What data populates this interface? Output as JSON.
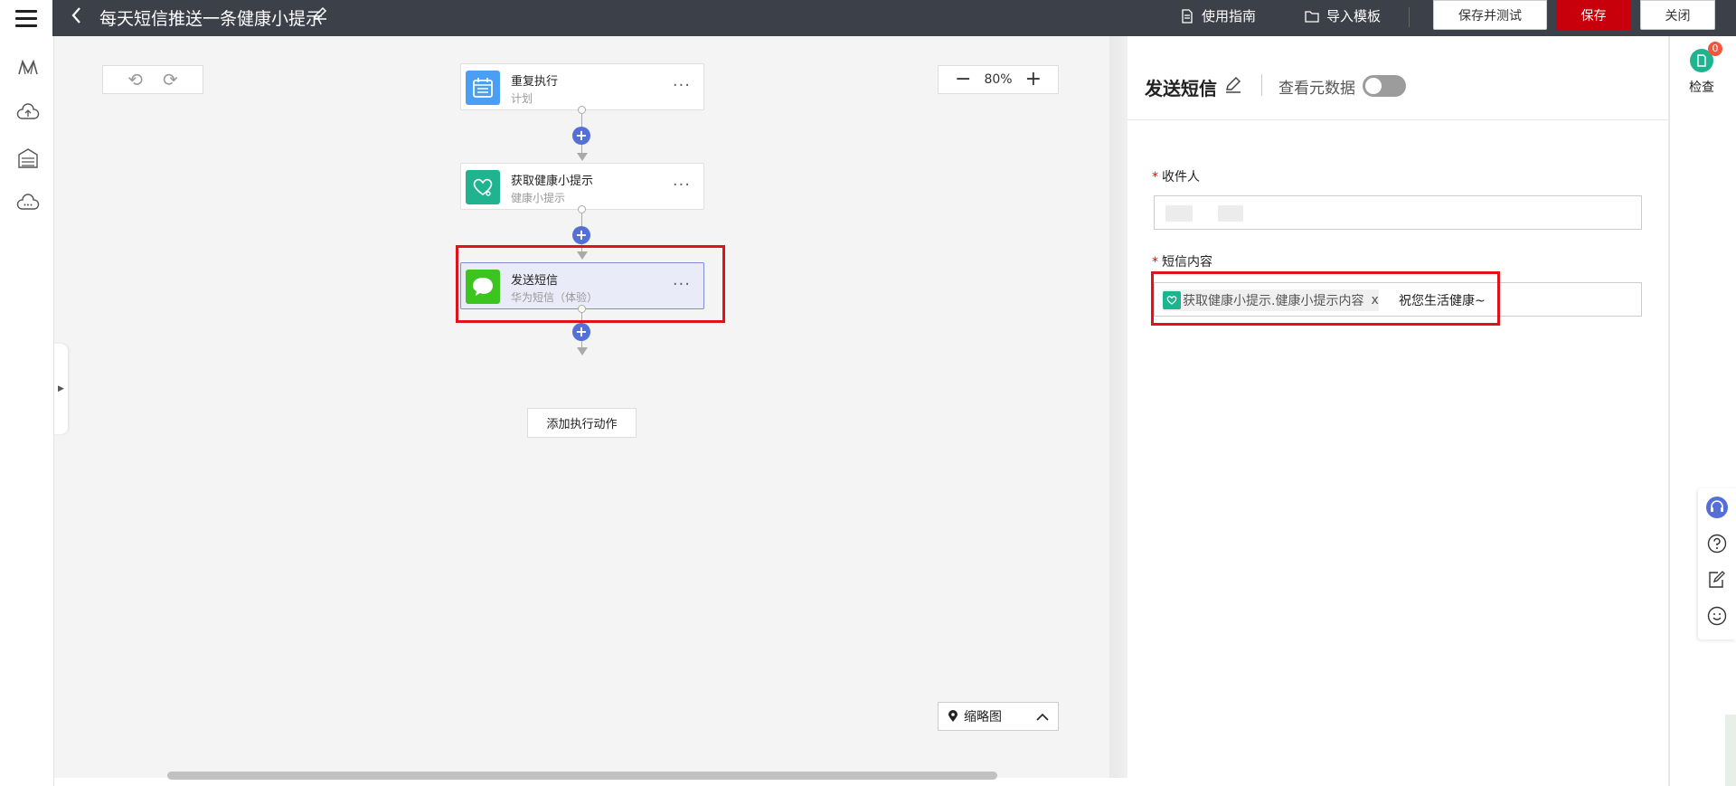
{
  "header": {
    "title": "每天短信推送一条健康小提示",
    "usage_guide": "使用指南",
    "import_template": "导入模板",
    "save_and_test": "保存并测试",
    "save": "保存",
    "close": "关闭"
  },
  "canvas": {
    "zoom": "80%",
    "nodes": [
      {
        "title": "重复执行",
        "subtitle": "计划"
      },
      {
        "title": "获取健康小提示",
        "subtitle": "健康小提示"
      },
      {
        "title": "发送短信",
        "subtitle": "华为短信（体验）"
      }
    ],
    "add_action": "添加执行动作",
    "minimap": "缩略图",
    "more": "···"
  },
  "panel": {
    "title": "发送短信",
    "view_metadata": "查看元数据",
    "recipient_label": "收件人",
    "content_label": "短信内容",
    "chip_text": "获取健康小提示.健康小提示内容",
    "chip_close": "x",
    "content_text": "祝您生活健康~",
    "required_mark": "*"
  },
  "right_bar": {
    "check_label": "检查",
    "check_badge": "0"
  },
  "colors": {
    "topbar": "#3c4049",
    "primary": "#c7000b",
    "highlight": "#e0121b",
    "plus": "#5470d6",
    "green": "#1fb48f"
  }
}
